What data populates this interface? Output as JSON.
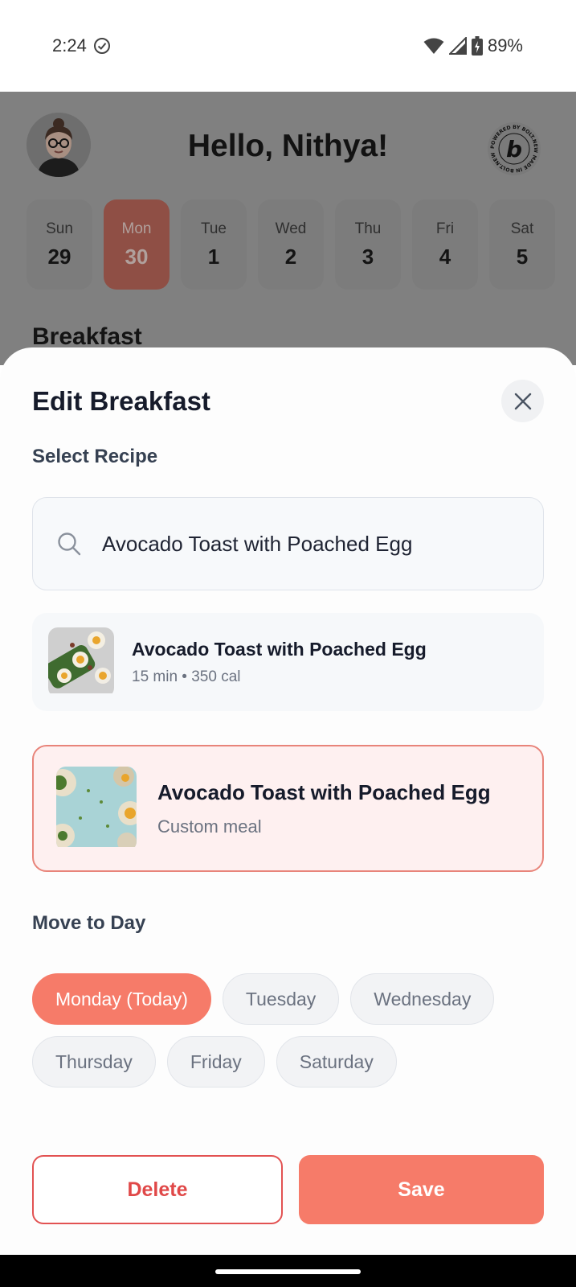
{
  "status_bar": {
    "time": "2:24",
    "battery": "89%",
    "icons": [
      "check-circle-icon",
      "wifi-icon",
      "signal-icon",
      "battery-icon"
    ]
  },
  "background": {
    "greeting": "Hello, Nithya!",
    "bolt_badge": {
      "ring_text": "POWERED BY BOLT.NEW MADE IN BOLT.NEW",
      "letter": "b"
    },
    "days": [
      {
        "name": "Sun",
        "num": "29"
      },
      {
        "name": "Mon",
        "num": "30"
      },
      {
        "name": "Tue",
        "num": "1"
      },
      {
        "name": "Wed",
        "num": "2"
      },
      {
        "name": "Thu",
        "num": "3"
      },
      {
        "name": "Fri",
        "num": "4"
      },
      {
        "name": "Sat",
        "num": "5"
      }
    ],
    "section_title": "Breakfast"
  },
  "sheet": {
    "title": "Edit Breakfast",
    "select_recipe_label": "Select Recipe",
    "search_value": "Avocado Toast with Poached Egg",
    "result": {
      "title": "Avocado Toast with Poached Egg",
      "meta": "15 min • 350 cal"
    },
    "selected": {
      "title": "Avocado Toast with Poached Egg",
      "subtitle": "Custom meal"
    },
    "move_label": "Move to Day",
    "day_chips": [
      "Monday (Today)",
      "Tuesday",
      "Wednesday",
      "Thursday",
      "Friday",
      "Saturday"
    ],
    "delete_label": "Delete",
    "save_label": "Save"
  },
  "colors": {
    "accent": "#f67b69",
    "danger": "#e25252"
  }
}
